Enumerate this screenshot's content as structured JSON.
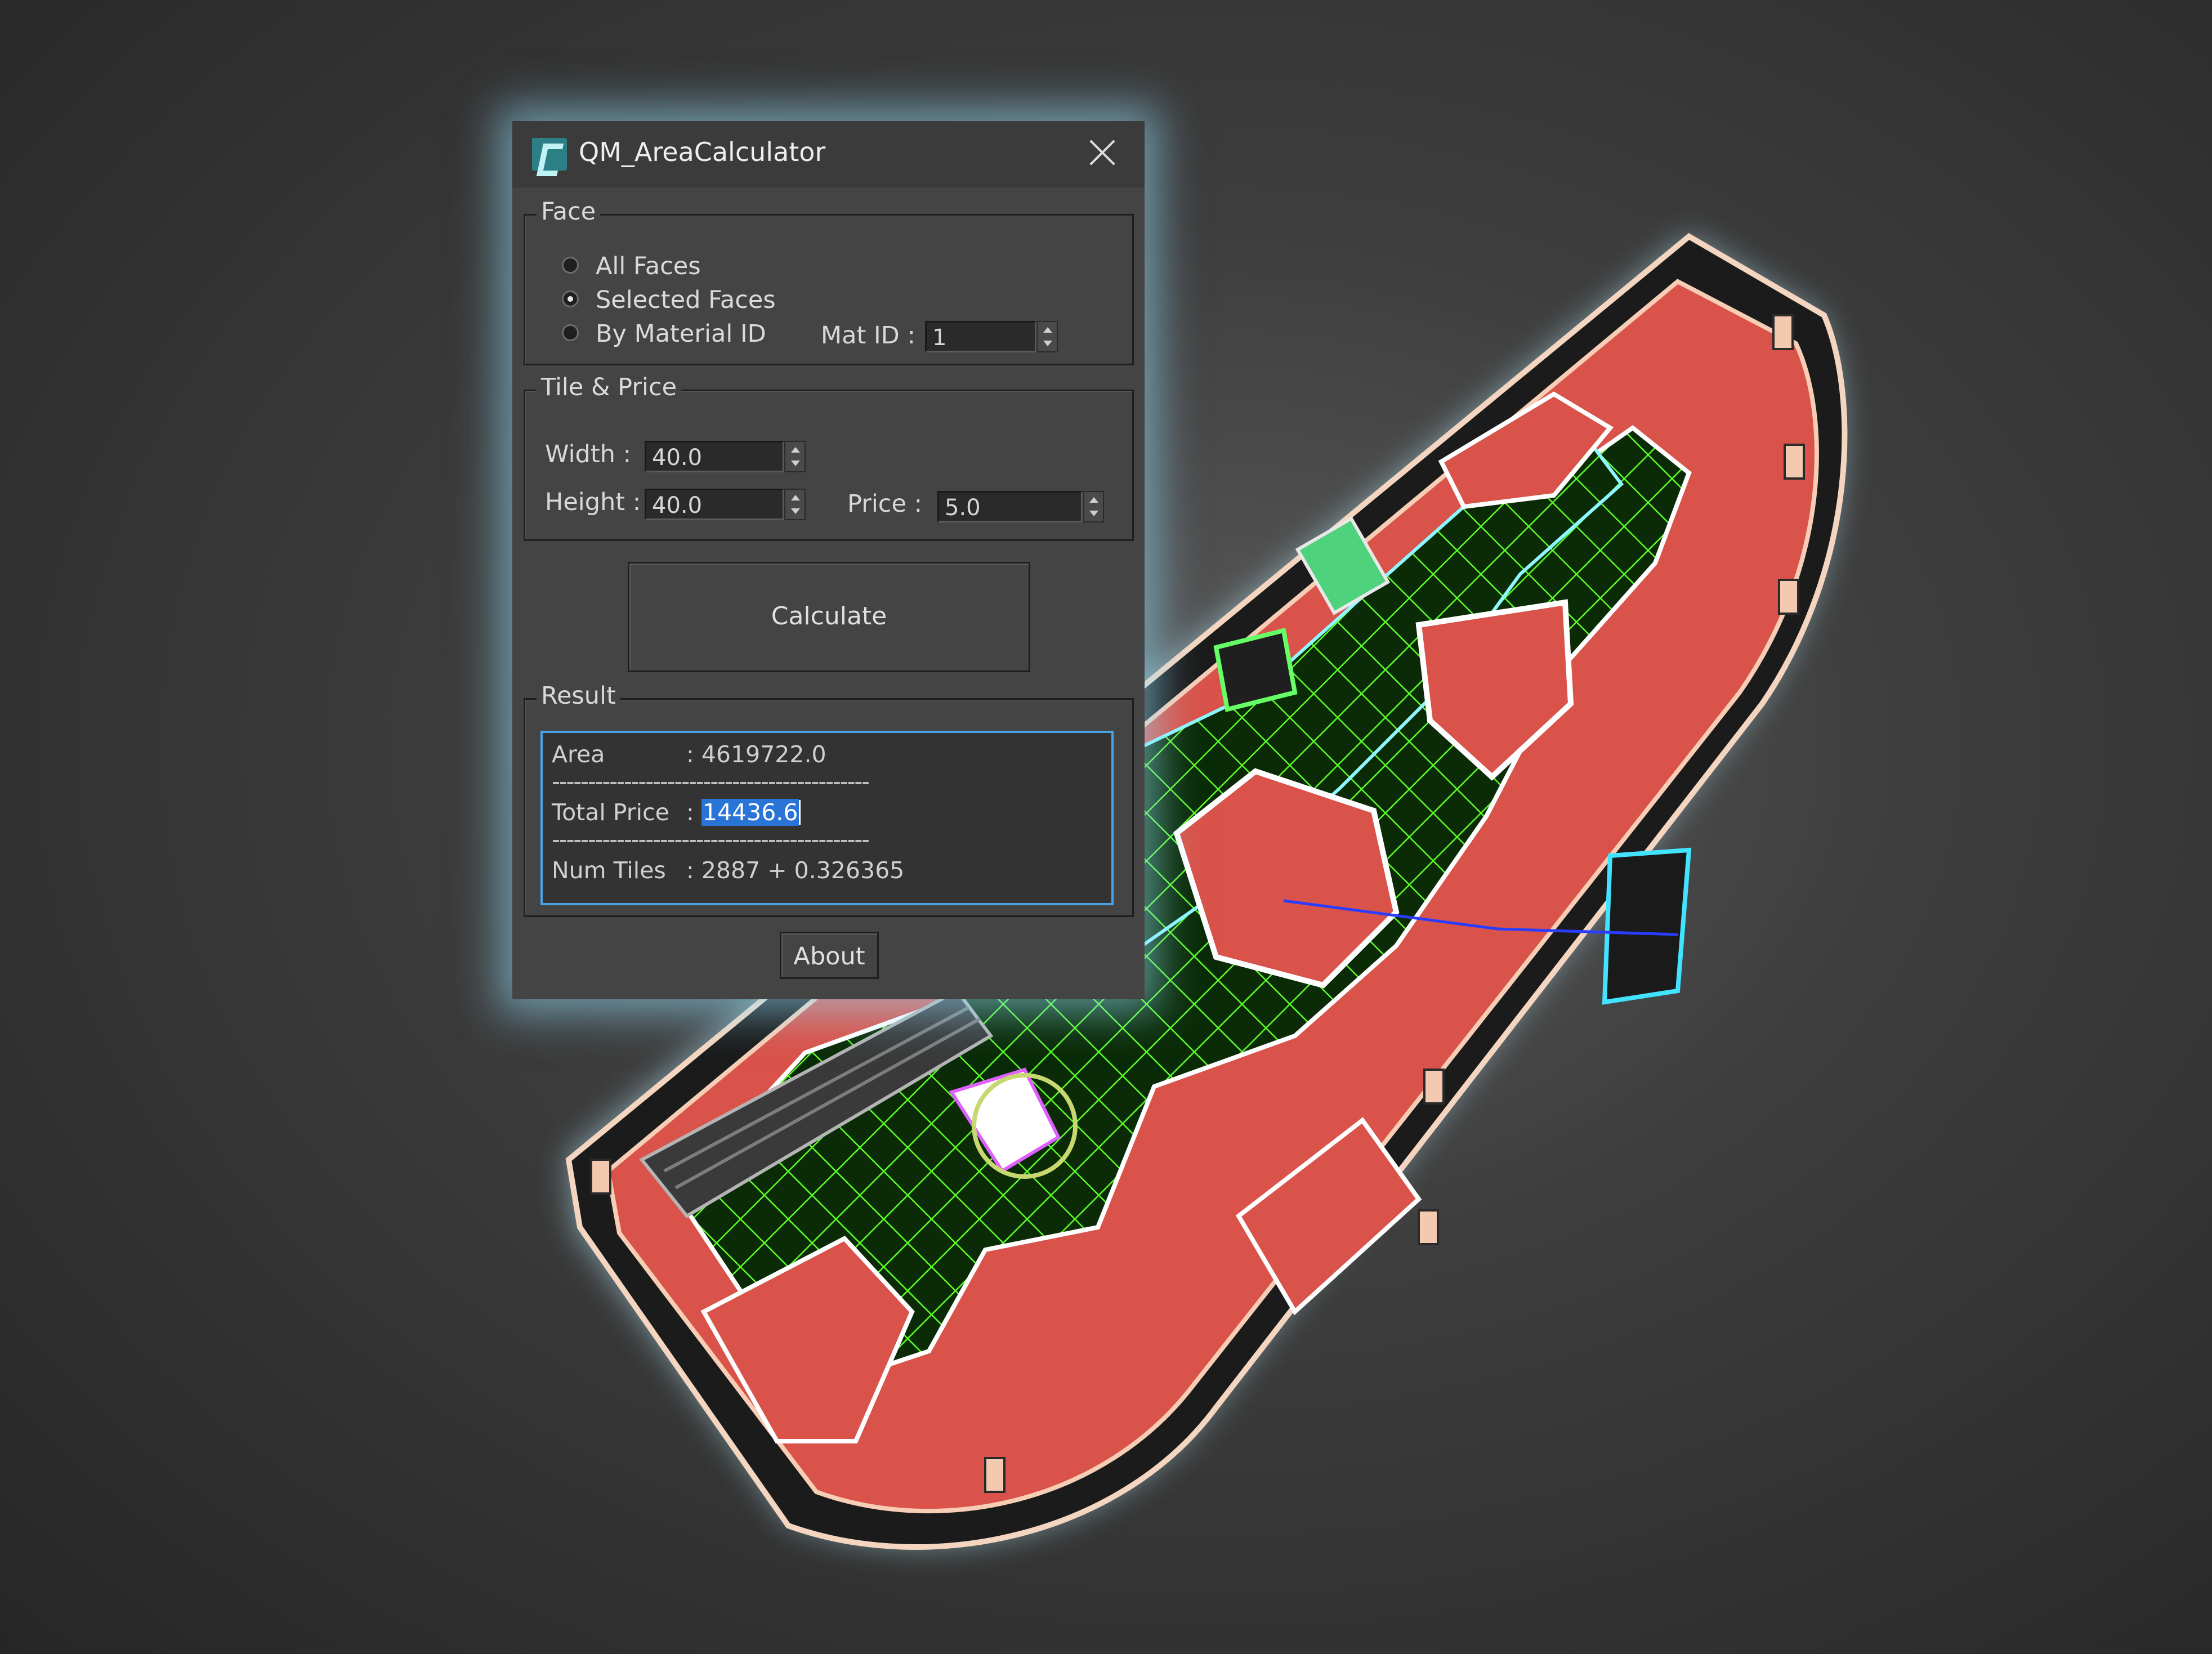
{
  "window": {
    "title": "QM_AreaCalculator",
    "icon": "3dsmax-app-icon",
    "close_icon": "close-icon"
  },
  "face_group": {
    "label": "Face",
    "options": [
      {
        "label": "All Faces",
        "selected": false
      },
      {
        "label": "Selected Faces",
        "selected": true
      },
      {
        "label": "By Material ID",
        "selected": false
      }
    ],
    "mat_id_label": "Mat ID :",
    "mat_id_value": "1"
  },
  "tile_group": {
    "label": "Tile & Price",
    "width_label": "Width  :",
    "width_value": "40.0",
    "height_label": "Height :",
    "height_value": "40.0",
    "price_label": "Price  :",
    "price_value": "5.0"
  },
  "calculate_label": "Calculate",
  "result_group": {
    "label": "Result",
    "area_label": "Area",
    "area_value": ": 4619722.0",
    "separator": "--------------------------------------------",
    "total_price_label": "Total Price",
    "total_price_colon": ":",
    "total_price_value": "14436.6",
    "num_tiles_label": "Num Tiles",
    "num_tiles_value": ": 2887 + 0.326365"
  },
  "about_label": "About",
  "colors": {
    "dialog_bg": "#444444",
    "glow": "#96e1ff",
    "floor_red": "#d9534a",
    "tile_grid_green": "#5cff2a",
    "selection_blue": "#2a74d8"
  }
}
